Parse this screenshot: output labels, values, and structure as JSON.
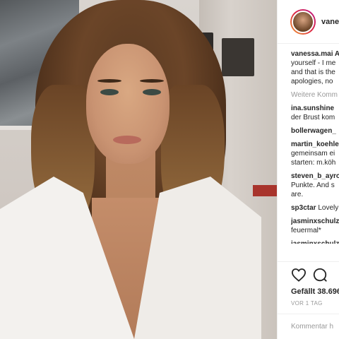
{
  "post": {
    "author": "vanessa.mai",
    "header_username": "vanes",
    "caption_lines": [
      "vanessa.mai A",
      "yourself - I me",
      "and that is the",
      "apologies, no"
    ],
    "more_comments_label": "Weitere Komm",
    "comments": [
      {
        "user": "ina.sunshine",
        "lines": [
          "der Brust kom"
        ]
      },
      {
        "user": "bollerwagen_",
        "lines": []
      },
      {
        "user": "martin_koehle",
        "lines": [
          "gemeinsam ei",
          "starten: m.köh"
        ]
      },
      {
        "user": "steven_b_ayro",
        "lines": [
          "Punkte. And s",
          "are."
        ]
      },
      {
        "user": "sp3ctar",
        "text": "Lovely",
        "lines": []
      },
      {
        "user": "jasminxschulz",
        "lines": [
          "feuermal*"
        ]
      },
      {
        "user": "jasminxschulz",
        "lines": []
      }
    ],
    "likes_label": "Gefällt 38.696",
    "timestamp": "VOR 1 TAG",
    "add_comment_placeholder": "Kommentar h"
  },
  "icons": {
    "like": "heart-icon",
    "comment": "comment-icon"
  }
}
